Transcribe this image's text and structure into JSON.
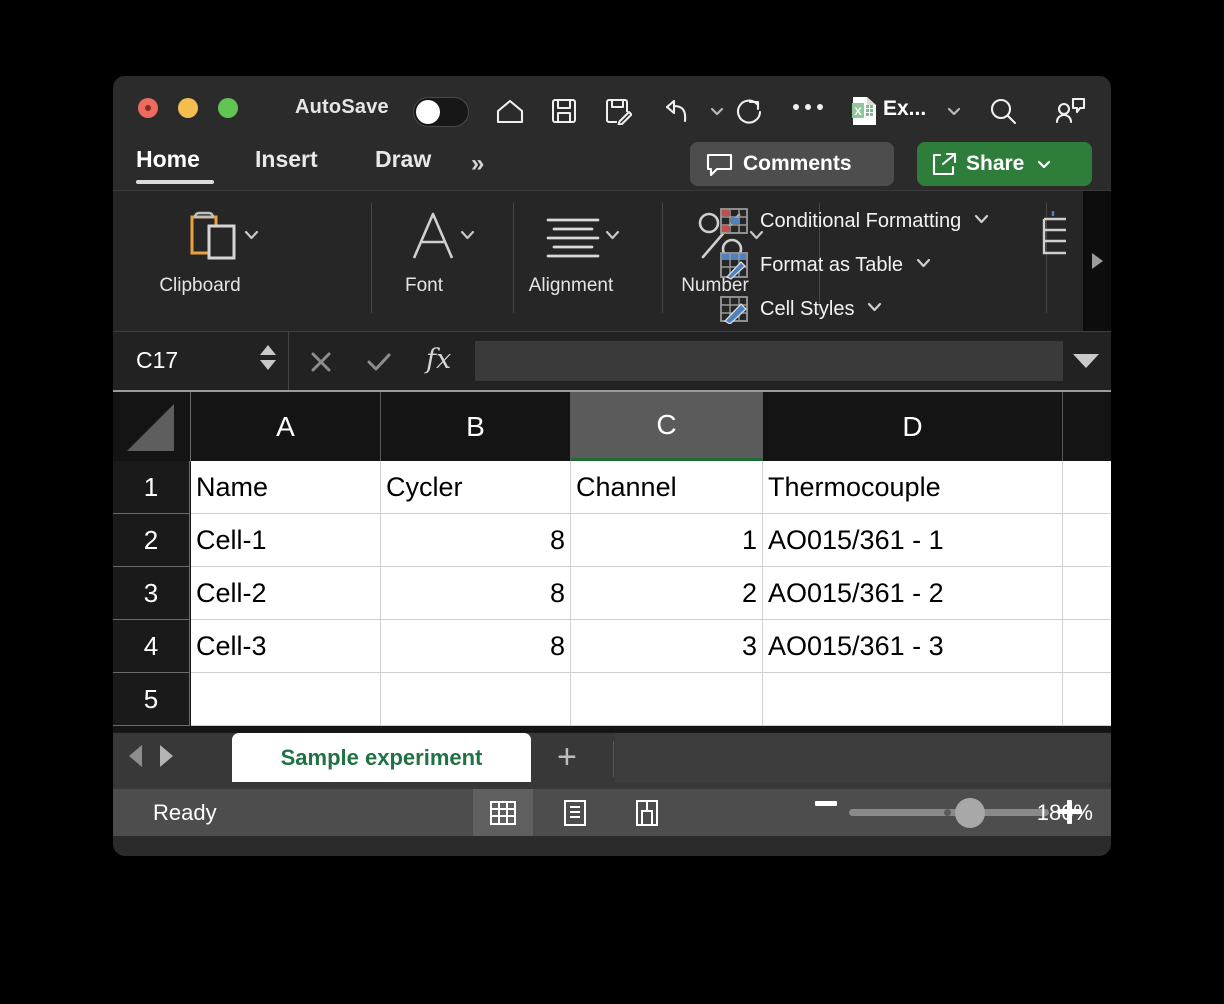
{
  "window": {
    "traffic_lights": [
      "close",
      "minimize",
      "maximize"
    ],
    "autosave_label": "AutoSave",
    "autosave_state": "off",
    "app_name": "Ex...",
    "accent_green": "#2f7d3b",
    "sheet_tab_green": "#207245"
  },
  "quick_access": [
    {
      "name": "home-icon",
      "label": "Home"
    },
    {
      "name": "save-icon",
      "label": "Save"
    },
    {
      "name": "save-as-icon",
      "label": "Save As"
    },
    {
      "name": "undo-icon",
      "label": "Undo"
    },
    {
      "name": "undo-dropdown-icon",
      "label": "Undo options"
    },
    {
      "name": "redo-icon",
      "label": "Redo"
    },
    {
      "name": "more-options-icon",
      "label": "More"
    },
    {
      "name": "app-dropdown-icon",
      "label": "Excel menu"
    },
    {
      "name": "search-icon",
      "label": "Search"
    },
    {
      "name": "collaborators-icon",
      "label": "Collaborators"
    }
  ],
  "tabs": {
    "items": [
      {
        "label": "Home",
        "active": true
      },
      {
        "label": "Insert",
        "active": false
      },
      {
        "label": "Draw",
        "active": false
      }
    ],
    "overflow": "»",
    "comments_label": "Comments",
    "share_label": "Share"
  },
  "ribbon": {
    "groups": [
      {
        "label": "Clipboard",
        "icon": "clipboard-icon"
      },
      {
        "label": "Font",
        "icon": "font-icon"
      },
      {
        "label": "Alignment",
        "icon": "alignment-icon"
      },
      {
        "label": "Number",
        "icon": "number-percent-icon"
      }
    ],
    "style_items": [
      {
        "label": "Conditional Formatting",
        "icon": "conditional-formatting-icon"
      },
      {
        "label": "Format as Table",
        "icon": "format-as-table-icon"
      },
      {
        "label": "Cell Styles",
        "icon": "cell-styles-icon"
      }
    ]
  },
  "formula_bar": {
    "name_box_value": "C17",
    "cancel_label": "✕",
    "confirm_label": "✓",
    "fx_label": "fx",
    "formula_value": "",
    "formula_placeholder": ""
  },
  "grid": {
    "columns": [
      "A",
      "B",
      "C",
      "D"
    ],
    "selected_column": "C",
    "rows": [
      "1",
      "2",
      "3",
      "4",
      "5"
    ],
    "data": [
      {
        "A": "Name",
        "B": "Cycler",
        "C": "Channel",
        "D": "Thermocouple"
      },
      {
        "A": "Cell-1",
        "B": "8",
        "C": "1",
        "D": "AO015/361 - 1"
      },
      {
        "A": "Cell-2",
        "B": "8",
        "C": "2",
        "D": "AO015/361 - 2"
      },
      {
        "A": "Cell-3",
        "B": "8",
        "C": "3",
        "D": "AO015/361 - 3"
      },
      {
        "A": "",
        "B": "",
        "C": "",
        "D": ""
      }
    ],
    "align": {
      "A": "txt",
      "B": "num",
      "C": "num",
      "D": "txt"
    },
    "header_align": {
      "A": "txt",
      "B": "txt",
      "C": "txt",
      "D": "txt"
    }
  },
  "sheet_bar": {
    "prev_label": "Previous sheet",
    "next_label": "Next sheet",
    "active_sheet": "Sample experiment",
    "add_sheet_label": "+"
  },
  "status_bar": {
    "status_text": "Ready",
    "views": [
      {
        "name": "normal-view-icon",
        "active": true
      },
      {
        "name": "page-layout-view-icon",
        "active": false
      },
      {
        "name": "page-break-view-icon",
        "active": false
      }
    ],
    "zoom_out_label": "−",
    "zoom_in_label": "+",
    "zoom_level": "180%"
  }
}
